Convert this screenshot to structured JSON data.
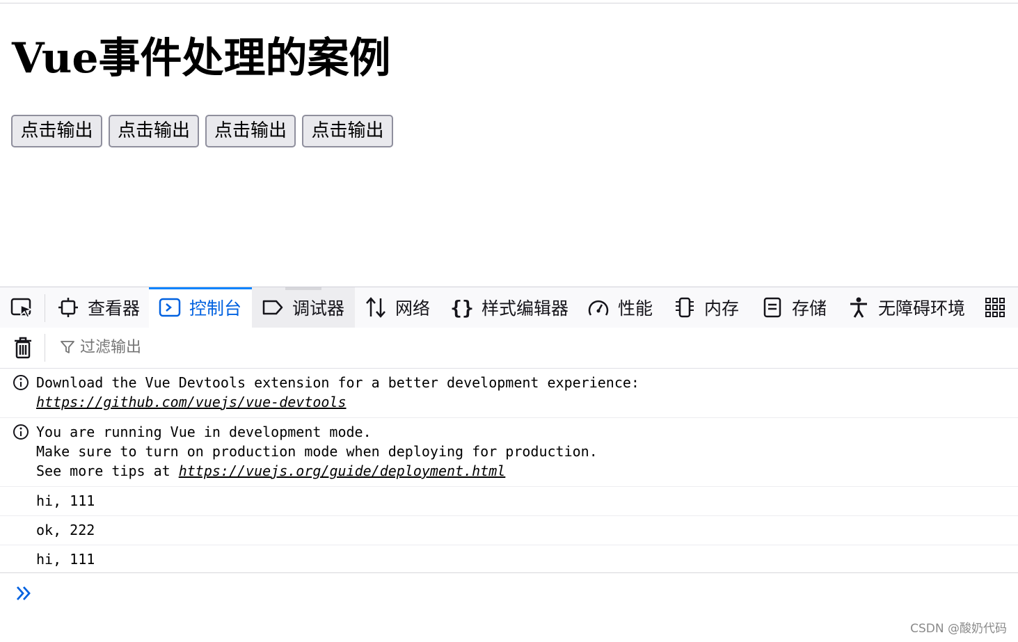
{
  "page": {
    "title": "Vue事件处理的案例",
    "buttons": [
      "点击输出",
      "点击输出",
      "点击输出",
      "点击输出"
    ]
  },
  "devtools": {
    "tabs": [
      {
        "label": "查看器",
        "icon": "inspector-icon"
      },
      {
        "label": "控制台",
        "icon": "console-icon",
        "active": true
      },
      {
        "label": "调试器",
        "icon": "debugger-icon"
      },
      {
        "label": "网络",
        "icon": "network-icon"
      },
      {
        "label": "样式编辑器",
        "icon": "style-editor-icon"
      },
      {
        "label": "性能",
        "icon": "performance-icon"
      },
      {
        "label": "内存",
        "icon": "memory-icon"
      },
      {
        "label": "存储",
        "icon": "storage-icon"
      },
      {
        "label": "无障碍环境",
        "icon": "accessibility-icon"
      }
    ],
    "filter_placeholder": "过滤输出",
    "messages": [
      {
        "type": "info",
        "line1": "Download the Vue Devtools extension for a better development experience:",
        "link": "https://github.com/vuejs/vue-devtools"
      },
      {
        "type": "info",
        "line1": "You are running Vue in development mode.",
        "line2": "Make sure to turn on production mode when deploying for production.",
        "line3_prefix": "See more tips at ",
        "link": "https://vuejs.org/guide/deployment.html"
      },
      {
        "type": "log",
        "text": "hi, 111"
      },
      {
        "type": "log",
        "text": "ok, 222"
      },
      {
        "type": "log",
        "text": "hi, 111"
      }
    ]
  },
  "watermark": "CSDN @酸奶代码",
  "colors": {
    "accent": "#0061e0",
    "active_tab_bar": "#0a84ff",
    "button_bg": "#e9e9ed",
    "button_border": "#8f8f9d"
  }
}
